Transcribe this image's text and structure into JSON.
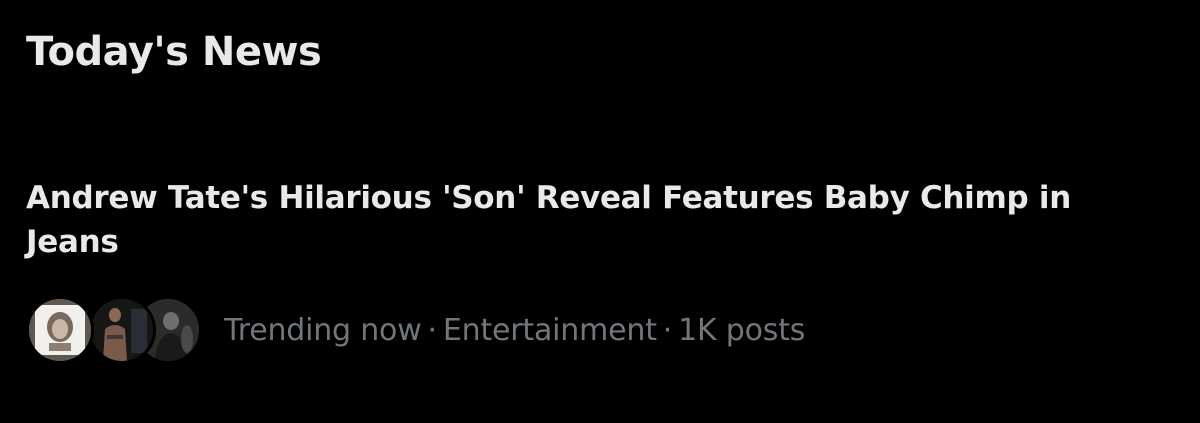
{
  "section": {
    "title": "Today's News"
  },
  "story": {
    "headline": "Andrew Tate's Hilarious 'Son' Reveal Features Baby Chimp in Jeans",
    "meta": {
      "status": "Trending now",
      "separator": "·",
      "category": "Entertainment",
      "post_count": "1K posts"
    },
    "avatars": [
      {
        "icon": "avatar-photo-1"
      },
      {
        "icon": "avatar-photo-2"
      },
      {
        "icon": "avatar-photo-3"
      }
    ]
  },
  "colors": {
    "background": "#000000",
    "primary_text": "#e7e9ea",
    "secondary_text": "#71767b"
  }
}
